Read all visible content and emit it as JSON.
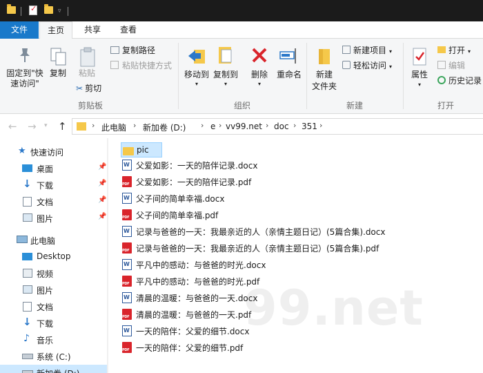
{
  "ribbon_tabs": {
    "file": "文件",
    "home": "主页",
    "share": "共享",
    "view": "查看"
  },
  "clipboard": {
    "pin_quick_access_line1": "固定到\"快",
    "pin_quick_access_line2": "速访问\"",
    "copy": "复制",
    "paste": "粘贴",
    "copy_path": "复制路径",
    "paste_shortcut": "粘贴快捷方式",
    "cut": "剪切",
    "group_label": "剪贴板"
  },
  "organize": {
    "move_to": "移动到",
    "copy_to": "复制到",
    "delete": "删除",
    "rename": "重命名",
    "group_label": "组织"
  },
  "new_group": {
    "new_folder_line1": "新建",
    "new_folder_line2": "文件夹",
    "new_item": "新建项目",
    "easy_access": "轻松访问",
    "group_label": "新建"
  },
  "open_group": {
    "properties": "属性",
    "open": "打开",
    "edit": "编辑",
    "history": "历史记录",
    "group_label": "打开"
  },
  "breadcrumbs": [
    "此电脑",
    "新加卷 (D:)",
    "e",
    "vv99.net",
    "doc",
    "351"
  ],
  "nav_pane": {
    "quick_access": "快速访问",
    "quick_items": [
      "桌面",
      "下载",
      "文档",
      "图片"
    ],
    "this_pc": "此电脑",
    "pc_items": [
      "Desktop",
      "视频",
      "图片",
      "文档",
      "下载",
      "音乐",
      "系统 (C:)",
      "新加卷 (D:)"
    ]
  },
  "files": [
    {
      "name": "pic",
      "type": "folder"
    },
    {
      "name": "父爱如影：一天的陪伴记录.docx",
      "type": "word"
    },
    {
      "name": "父爱如影：一天的陪伴记录.pdf",
      "type": "pdf"
    },
    {
      "name": "父子间的简单幸福.docx",
      "type": "word"
    },
    {
      "name": "父子间的简单幸福.pdf",
      "type": "pdf"
    },
    {
      "name": "记录与爸爸的一天：我最亲近的人（亲情主题日记）(5篇合集).docx",
      "type": "word"
    },
    {
      "name": "记录与爸爸的一天：我最亲近的人（亲情主题日记）(5篇合集).pdf",
      "type": "pdf"
    },
    {
      "name": "平凡中的感动：与爸爸的时光.docx",
      "type": "word"
    },
    {
      "name": "平凡中的感动：与爸爸的时光.pdf",
      "type": "pdf"
    },
    {
      "name": "清晨的温暖：与爸爸的一天.docx",
      "type": "word"
    },
    {
      "name": "清晨的温暖：与爸爸的一天.pdf",
      "type": "pdf"
    },
    {
      "name": "一天的陪伴：父爱的细节.docx",
      "type": "word"
    },
    {
      "name": "一天的陪伴：父爱的细节.pdf",
      "type": "pdf"
    }
  ],
  "watermark": "99.net",
  "colors": {
    "accent": "#1979ca",
    "selection": "#cce8ff",
    "titlebar": "#1b1b1b",
    "ribbon_bg": "#f5f6f7"
  }
}
